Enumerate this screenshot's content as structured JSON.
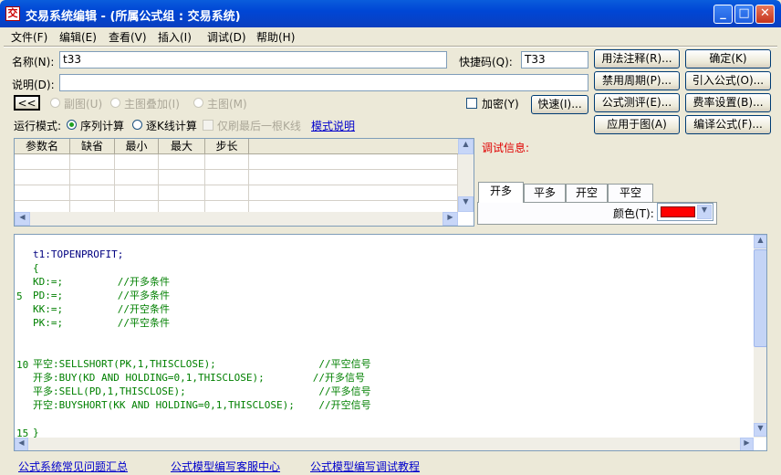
{
  "window": {
    "title": "交易系统编辑 - (所属公式组 : 交易系统)"
  },
  "menu": [
    "文件(F)",
    "编辑(E)",
    "查看(V)",
    "插入(I)",
    "调试(D)",
    "帮助(H)"
  ],
  "form": {
    "name_label": "名称(N):",
    "name_value": "t33",
    "shortcut_label": "快捷码(Q):",
    "shortcut_value": "T33",
    "desc_label": "说明(D):",
    "desc_value": "",
    "back_btn": "<<",
    "radio_sub": "副图(U)",
    "radio_main_overlay": "主图叠加(I)",
    "radio_main": "主图(M)",
    "encrypt": "加密(Y)",
    "fast_btn": "快速(I)...",
    "run_mode_label": "运行模式:",
    "mode_seq": "序列计算",
    "mode_step": "逐K线计算",
    "last_only": "仅刷最后一根K线",
    "mode_help": "模式说明"
  },
  "side_buttons": {
    "usage": "用法注释(R)...",
    "ok": "确定(K)",
    "ban_period": "禁用周期(P)...",
    "import": "引入公式(O)...",
    "test": "公式测评(E)...",
    "fee": "费率设置(B)...",
    "apply": "应用于图(A)",
    "compile": "编译公式(F)..."
  },
  "params": {
    "columns": [
      "参数名",
      "缺省",
      "最小",
      "最大",
      "步长"
    ]
  },
  "debug": {
    "label": "调试信息:"
  },
  "tabs": [
    "开多",
    "平多",
    "开空",
    "平空"
  ],
  "color": {
    "label": "颜色(T):",
    "value": "#ff0000"
  },
  "code": {
    "lines": [
      {
        "num": "",
        "text": "t1:TOPENPROFIT;",
        "color": "#000080"
      },
      {
        "num": "",
        "text": "{",
        "color": "#008000"
      },
      {
        "num": "",
        "text": "KD:=;         //开多条件",
        "color": "#008000"
      },
      {
        "num": "5",
        "text": "PD:=;         //平多条件",
        "color": "#008000"
      },
      {
        "num": "",
        "text": "KK:=;         //开空条件",
        "color": "#008000"
      },
      {
        "num": "",
        "text": "PK:=;         //平空条件",
        "color": "#008000"
      },
      {
        "num": "",
        "text": "",
        "color": "#008000"
      },
      {
        "num": "",
        "text": "",
        "color": "#008000"
      },
      {
        "num": "10",
        "text": "平空:SELLSHORT(PK,1,THISCLOSE);                 //平空信号",
        "color": "#008000"
      },
      {
        "num": "",
        "text": "开多:BUY(KD AND HOLDING=0,1,THISCLOSE);        //开多信号",
        "color": "#008000"
      },
      {
        "num": "",
        "text": "平多:SELL(PD,1,THISCLOSE);                      //平多信号",
        "color": "#008000"
      },
      {
        "num": "",
        "text": "开空:BUYSHORT(KK AND HOLDING=0,1,THISCLOSE);    //开空信号",
        "color": "#008000"
      },
      {
        "num": "",
        "text": "",
        "color": "#008000"
      },
      {
        "num": "15",
        "text": "}",
        "color": "#008000"
      }
    ]
  },
  "footer_links": [
    "公式系统常见问题汇总",
    "公式模型编写客服中心",
    "公式模型编写调试教程"
  ]
}
